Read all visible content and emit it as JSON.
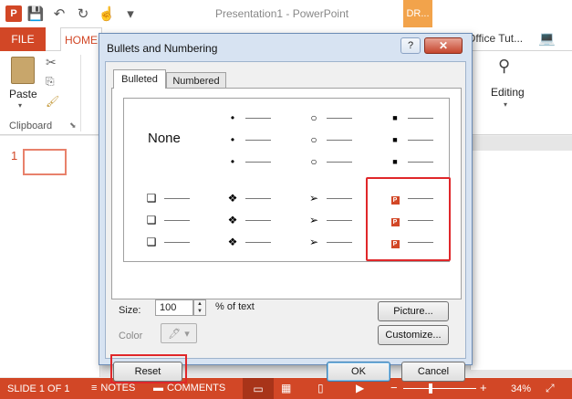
{
  "app": {
    "title": "Presentation1 - PowerPoint",
    "context_tab": "DR...",
    "ppt_logo": "P",
    "tabs": {
      "file": "FILE",
      "home": "HOME"
    },
    "office_tutorials": "Office Tut...",
    "ribbon": {
      "paste": "Paste",
      "clipboard": "Clipboard",
      "editing": "Editing"
    },
    "slide_number": "1",
    "status": {
      "slide_of": "SLIDE 1 OF 1",
      "notes": "NOTES",
      "comments": "COMMENTS",
      "zoom": "34%",
      "zoom_fraction": 0.34
    },
    "icons": {
      "save": "💾",
      "undo": "↶",
      "redo": "↻",
      "touch": "☝",
      "more": "▾",
      "cut": "✂",
      "copy": "⎘",
      "brush": "🖌",
      "binoculars": "⚲",
      "account": "💻",
      "notes": "≡",
      "comments": "▬",
      "normal": "▭",
      "sorter": "▦",
      "reading": "▯",
      "show": "▶",
      "fit": "⤢",
      "launcher": "⬊"
    }
  },
  "dialog": {
    "title": "Bullets and Numbering",
    "help": "?",
    "close": "✕",
    "tabs": {
      "bulleted": "Bulleted",
      "numbered": "Numbered"
    },
    "none_label": "None",
    "bullet_styles": [
      {
        "symbol": ""
      },
      {
        "symbol": "•"
      },
      {
        "symbol": "○"
      },
      {
        "symbol": "■"
      },
      {
        "symbol": "❑"
      },
      {
        "symbol": "❖"
      },
      {
        "symbol": "➢"
      },
      {
        "symbol": "ppt-icon"
      }
    ],
    "size_label": "Size:",
    "size_value": "100",
    "percent_text": "% of text",
    "color_label": "Color",
    "color_icon": "🖊",
    "color_arrow": "▾",
    "spin_up": "▲",
    "spin_down": "▼",
    "buttons": {
      "picture": "Picture...",
      "customize": "Customize...",
      "reset": "Reset",
      "ok": "OK",
      "cancel": "Cancel"
    },
    "highlight_color": "#e0272a"
  },
  "colors": {
    "accent": "#d24726",
    "dialog_frame": "#d7e3f2"
  }
}
